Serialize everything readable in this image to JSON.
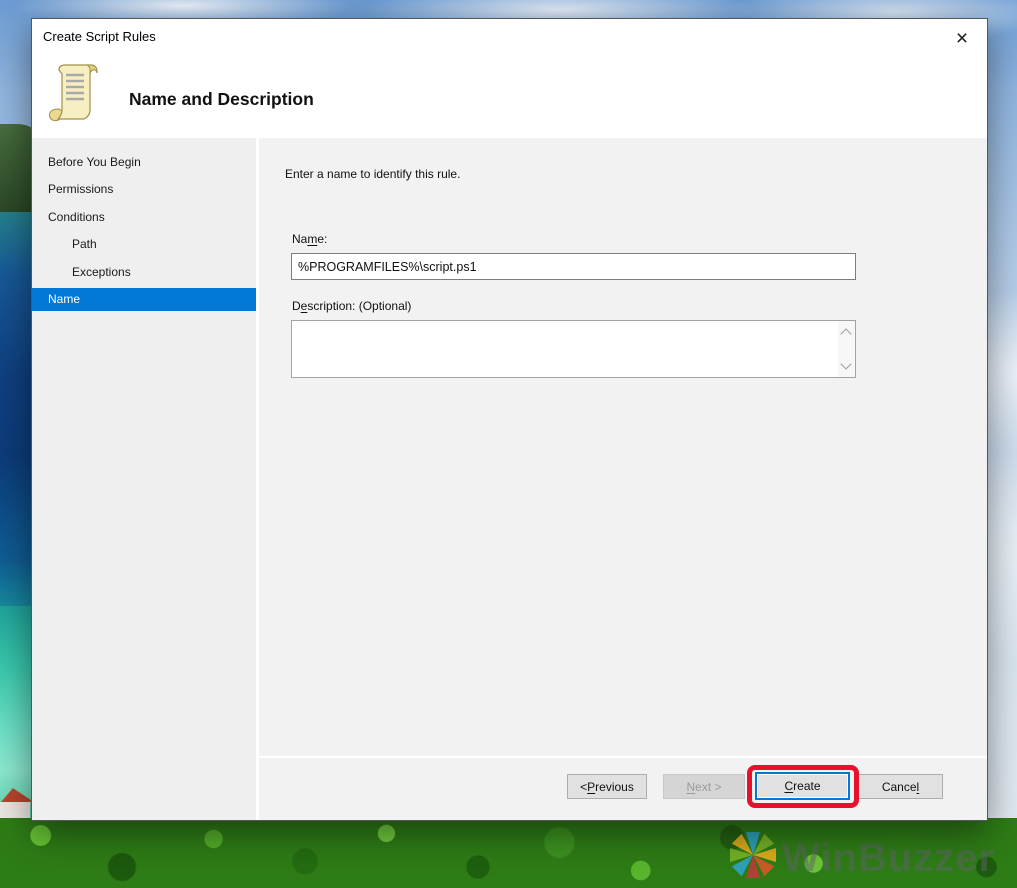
{
  "window": {
    "title": "Create Script Rules",
    "close_icon": "×"
  },
  "header": {
    "title": "Name and Description",
    "icon": "script-scroll-icon"
  },
  "sidebar": {
    "items": [
      {
        "label": "Before You Begin",
        "indent": false,
        "selected": false
      },
      {
        "label": "Permissions",
        "indent": false,
        "selected": false
      },
      {
        "label": "Conditions",
        "indent": false,
        "selected": false
      },
      {
        "label": "Path",
        "indent": true,
        "selected": false
      },
      {
        "label": "Exceptions",
        "indent": true,
        "selected": false
      },
      {
        "label": "Name",
        "indent": false,
        "selected": true
      }
    ]
  },
  "content": {
    "instruction": "Enter a name to identify this rule.",
    "name_label": {
      "pre": "Na",
      "key": "m",
      "post": "e:"
    },
    "name_value": "%PROGRAMFILES%\\script.ps1",
    "description_label": {
      "pre": "D",
      "key": "e",
      "post": "scription: (Optional)"
    },
    "description_value": ""
  },
  "buttons": {
    "previous": {
      "pre": "< ",
      "key": "P",
      "post": "revious",
      "enabled": true
    },
    "next": {
      "pre": "",
      "key": "N",
      "post": "ext >",
      "enabled": false
    },
    "create": {
      "pre": "",
      "key": "C",
      "post": "reate",
      "enabled": true,
      "focused": true,
      "highlighted": true
    },
    "cancel": {
      "pre": "Cance",
      "key": "l",
      "post": "",
      "enabled": true
    }
  },
  "annotation": {
    "color": "#e8112d"
  },
  "watermark": {
    "text": "WinBuzzer"
  },
  "colors": {
    "accent_blue": "#0078d7",
    "selected_nav_bg": "#0078d7",
    "annotation_red": "#e8112d",
    "panel_bg": "#f2f2f2",
    "dialog_bg": "#ffffff"
  }
}
